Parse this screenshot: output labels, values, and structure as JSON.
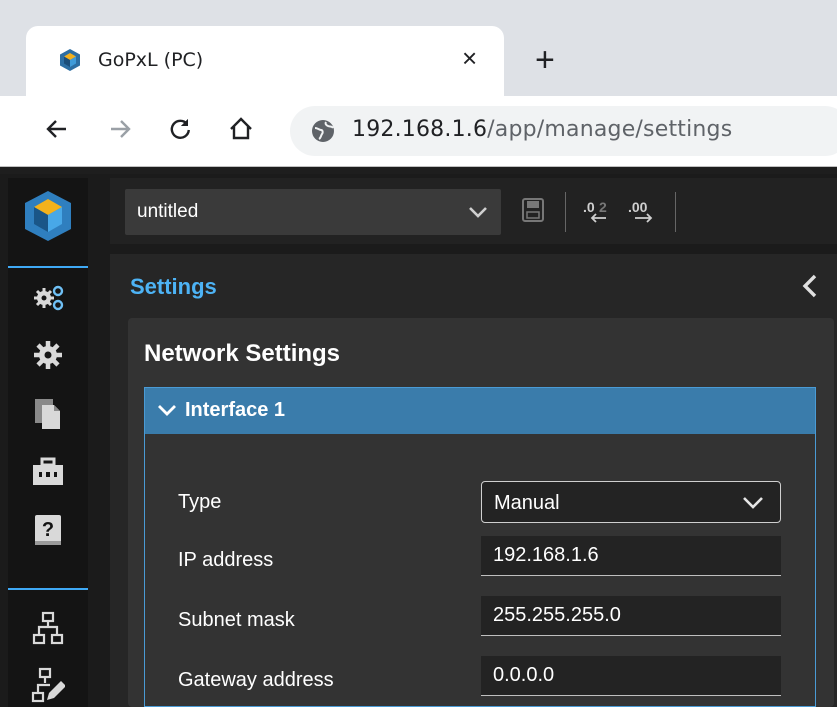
{
  "browser": {
    "tab_title": "GoPxL (PC)",
    "tab_close": "×",
    "new_tab": "+",
    "url_host": "192.168.1.6",
    "url_path": "/app/manage/settings"
  },
  "topbar": {
    "job_name": "untitled"
  },
  "panel": {
    "title": "Settings"
  },
  "network": {
    "title": "Network Settings",
    "interface_title": "Interface 1",
    "type_label": "Type",
    "type_value": "Manual",
    "ip_label": "IP address",
    "ip_value": "192.168.1.6",
    "subnet_label": "Subnet mask",
    "subnet_value": "255.255.255.0",
    "gateway_label": "Gateway address",
    "gateway_value": "0.0.0.0"
  },
  "colors": {
    "accent": "#3fa9f5",
    "header_bar": "#3a7cab"
  },
  "icons": {
    "sidebar": [
      "app-logo-icon",
      "system-settings-icon",
      "gear-icon",
      "documents-icon",
      "toolbox-icon",
      "help-icon",
      "network-icon",
      "network-edit-icon"
    ],
    "toolbar": [
      "save-icon",
      "import-icon",
      "export-icon"
    ]
  }
}
